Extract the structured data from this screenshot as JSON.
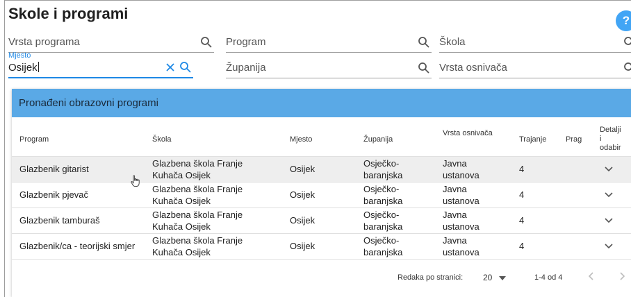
{
  "page": {
    "title": "Skole i programi",
    "help_label": "?"
  },
  "filters": {
    "vrsta_programa": {
      "placeholder": "Vrsta programa"
    },
    "program": {
      "placeholder": "Program"
    },
    "skola": {
      "placeholder": "Škola"
    },
    "mjesto": {
      "label": "Mjesto",
      "value": "Osijek"
    },
    "zupanija": {
      "placeholder": "Županija"
    },
    "vrsta_osnivaca": {
      "placeholder": "Vrsta osnivača"
    }
  },
  "results": {
    "title": "Pronađeni obrazovni programi",
    "columns": {
      "program": "Program",
      "skola": "Škola",
      "mjesto": "Mjesto",
      "zupanija": "Županija",
      "vrsta_osnivaca": "Vrsta osnivača",
      "trajanje": "Trajanje",
      "prag": "Prag",
      "detalji": [
        "Detalji",
        "i",
        "odabir"
      ]
    },
    "rows": [
      {
        "program": "Glazbenik gitarist",
        "skola": [
          "Glazbena škola Franje",
          "Kuhača Osijek"
        ],
        "mjesto": "Osijek",
        "zupanija": [
          "Osječko-",
          "baranjska"
        ],
        "vrsta_osnivaca": [
          "Javna",
          "ustanova"
        ],
        "trajanje": "4",
        "prag": ""
      },
      {
        "program": "Glazbenik pjevač",
        "skola": [
          "Glazbena škola Franje",
          "Kuhača Osijek"
        ],
        "mjesto": "Osijek",
        "zupanija": [
          "Osječko-",
          "baranjska"
        ],
        "vrsta_osnivaca": [
          "Javna",
          "ustanova"
        ],
        "trajanje": "4",
        "prag": ""
      },
      {
        "program": "Glazbenik tamburaš",
        "skola": [
          "Glazbena škola Franje",
          "Kuhača Osijek"
        ],
        "mjesto": "Osijek",
        "zupanija": [
          "Osječko-",
          "baranjska"
        ],
        "vrsta_osnivaca": [
          "Javna",
          "ustanova"
        ],
        "trajanje": "4",
        "prag": ""
      },
      {
        "program": "Glazbenik/ca - teorijski smjer",
        "skola": [
          "Glazbena škola Franje",
          "Kuhača Osijek"
        ],
        "mjesto": "Osijek",
        "zupanija": [
          "Osječko-",
          "baranjska"
        ],
        "vrsta_osnivaca": [
          "Javna",
          "ustanova"
        ],
        "trajanje": "4",
        "prag": ""
      }
    ],
    "pagination": {
      "rows_per_page_label": "Redaka po stranici:",
      "rows_per_page": "20",
      "range": "1-4 od 4"
    }
  },
  "icons": {
    "search": "search-icon",
    "clear": "close-icon",
    "expand": "chevron-down-icon",
    "prev": "chevron-left-icon",
    "next": "chevron-right-icon",
    "cursor": "hand-pointer-icon"
  },
  "colors": {
    "accent": "#1e88e5",
    "header_bar": "#5aa9e6",
    "help_button": "#42a5f5",
    "selected_row": "#eeeeee"
  }
}
